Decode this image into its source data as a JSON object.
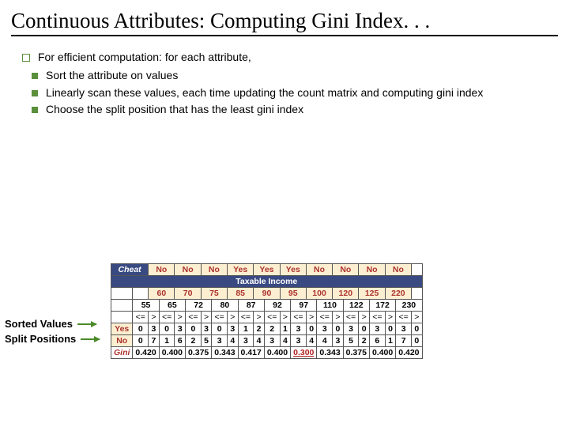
{
  "title": "Continuous Attributes: Computing Gini Index. . .",
  "top_bullet": "For efficient computation: for each attribute,",
  "sub_bullets": [
    "Sort the attribute on values",
    "Linearly scan these values, each time updating the count matrix and computing gini index",
    "Choose the split position that has the least gini index"
  ],
  "side_labels": {
    "sorted": "Sorted Values",
    "splits": "Split Positions"
  },
  "rows": {
    "cheat_label": "Cheat",
    "cheat": [
      "No",
      "No",
      "No",
      "Yes",
      "Yes",
      "Yes",
      "No",
      "No",
      "No",
      "No"
    ],
    "taxable_header": "Taxable Income",
    "sorted_values": [
      "60",
      "70",
      "75",
      "85",
      "90",
      "95",
      "100",
      "120",
      "125",
      "220"
    ],
    "split_positions": [
      "55",
      "65",
      "72",
      "80",
      "87",
      "92",
      "97",
      "110",
      "122",
      "172",
      "230"
    ],
    "ops": [
      "<=",
      ">"
    ],
    "yes_label": "Yes",
    "yes": [
      "0",
      "3",
      "0",
      "3",
      "0",
      "3",
      "0",
      "3",
      "1",
      "2",
      "2",
      "1",
      "3",
      "0",
      "3",
      "0",
      "3",
      "0",
      "3",
      "0",
      "3",
      "0"
    ],
    "no_label": "No",
    "no": [
      "0",
      "7",
      "1",
      "6",
      "2",
      "5",
      "3",
      "4",
      "3",
      "4",
      "3",
      "4",
      "3",
      "4",
      "4",
      "3",
      "5",
      "2",
      "6",
      "1",
      "7",
      "0"
    ],
    "gini_label": "Gini",
    "gini": [
      "0.420",
      "0.400",
      "0.375",
      "0.343",
      "0.417",
      "0.400",
      "0.300",
      "0.343",
      "0.375",
      "0.400",
      "0.420"
    ],
    "gini_best_index": 6
  }
}
